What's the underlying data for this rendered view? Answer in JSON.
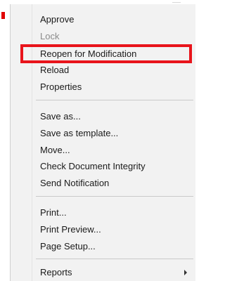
{
  "menu": {
    "items": [
      {
        "label": "Approve"
      },
      {
        "label": "Lock",
        "disabled": true
      },
      {
        "label": "Reopen for Modification",
        "highlighted": true
      },
      {
        "label": "Reload"
      },
      {
        "label": "Properties"
      },
      {
        "label": "Save as..."
      },
      {
        "label": "Save as template..."
      },
      {
        "label": "Move..."
      },
      {
        "label": "Check Document Integrity"
      },
      {
        "label": "Send Notification"
      },
      {
        "label": "Print..."
      },
      {
        "label": "Print Preview..."
      },
      {
        "label": "Page Setup..."
      },
      {
        "label": "Reports",
        "has_submenu": true
      }
    ]
  },
  "colors": {
    "menu_background": "#f2f2f2",
    "highlight_border": "#e8141b",
    "disabled_text": "#8a8a8a",
    "text": "#1a1a1a"
  },
  "icons": {
    "submenu": "chevron-right-icon"
  }
}
